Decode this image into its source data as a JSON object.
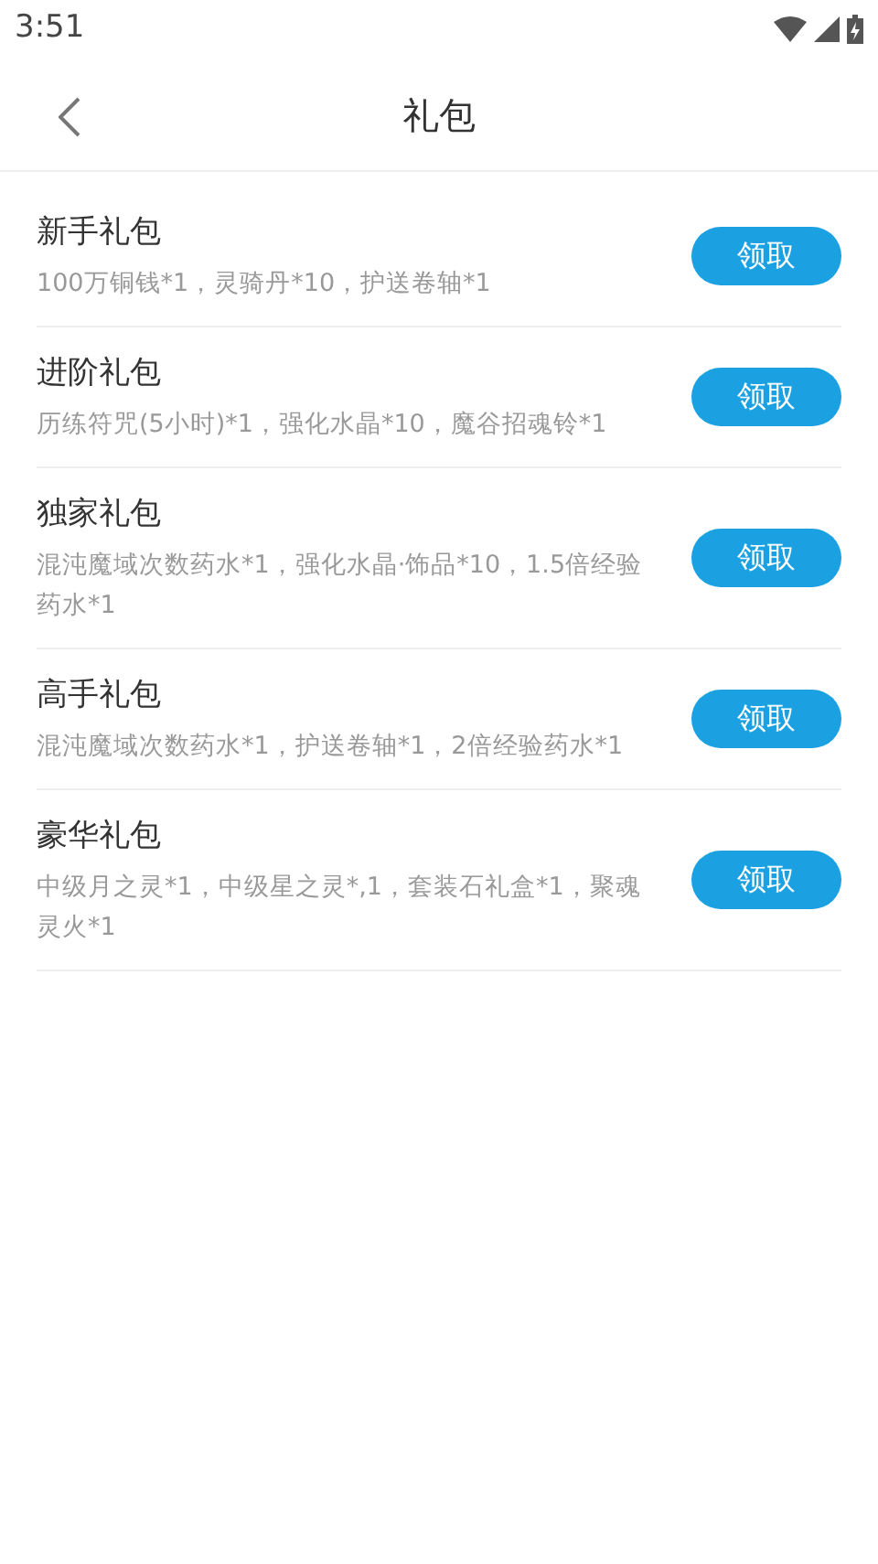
{
  "status_bar": {
    "time": "3:51"
  },
  "header": {
    "title": "礼包"
  },
  "gifts": [
    {
      "name": "新手礼包",
      "contents": "100万铜钱*1，灵骑丹*10，护送卷轴*1",
      "button": "领取"
    },
    {
      "name": "进阶礼包",
      "contents": "历练符咒(5小时)*1，强化水晶*10，魔谷招魂铃*1",
      "button": "领取"
    },
    {
      "name": "独家礼包",
      "contents": "混沌魔域次数药水*1，强化水晶·饰品*10，1.5倍经验药水*1",
      "button": "领取"
    },
    {
      "name": "高手礼包",
      "contents": "混沌魔域次数药水*1，护送卷轴*1，2倍经验药水*1",
      "button": "领取"
    },
    {
      "name": "豪华礼包",
      "contents": "中级月之灵*1，中级星之灵*,1，套装石礼盒*1，聚魂灵火*1",
      "button": "领取"
    }
  ]
}
